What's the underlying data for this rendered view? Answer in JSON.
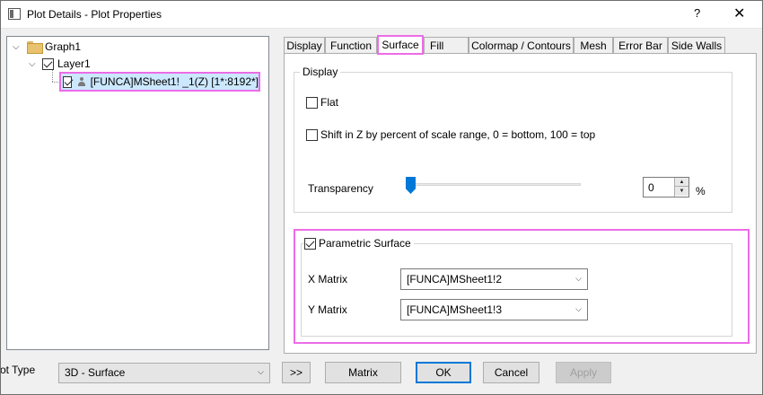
{
  "window": {
    "title": "Plot Details - Plot Properties",
    "help_label": "?",
    "close_label": "✕"
  },
  "tree": {
    "graph": "Graph1",
    "layer": "Layer1",
    "plot": "[FUNCA]MSheet1! _1(Z) [1*:8192*]"
  },
  "tabs": [
    "Display",
    "Function",
    "Surface",
    "Fill",
    "Colormap / Contours",
    "Mesh",
    "Error Bar",
    "Side Walls"
  ],
  "active_tab": "Surface",
  "display_group": {
    "label": "Display",
    "flat_label": "Flat",
    "flat_checked": false,
    "shift_label": "Shift in Z by percent of scale range, 0 = bottom, 100 = top",
    "shift_checked": false,
    "transparency_label": "Transparency",
    "transparency_value": "0",
    "transparency_unit": "%"
  },
  "parametric": {
    "label": "Parametric Surface",
    "checked": true,
    "x_label": "X Matrix",
    "x_value": "[FUNCA]MSheet1!2",
    "y_label": "Y Matrix",
    "y_value": "[FUNCA]MSheet1!3"
  },
  "footer": {
    "plot_type_label": "ot Type",
    "plot_type_value": "3D - Surface",
    "expand_label": ">>",
    "matrix_label": "Matrix",
    "ok_label": "OK",
    "cancel_label": "Cancel",
    "apply_label": "Apply"
  },
  "colors": {
    "highlight": "#ec6ce8",
    "selection": "#cce8ff",
    "accent": "#0078d7"
  }
}
